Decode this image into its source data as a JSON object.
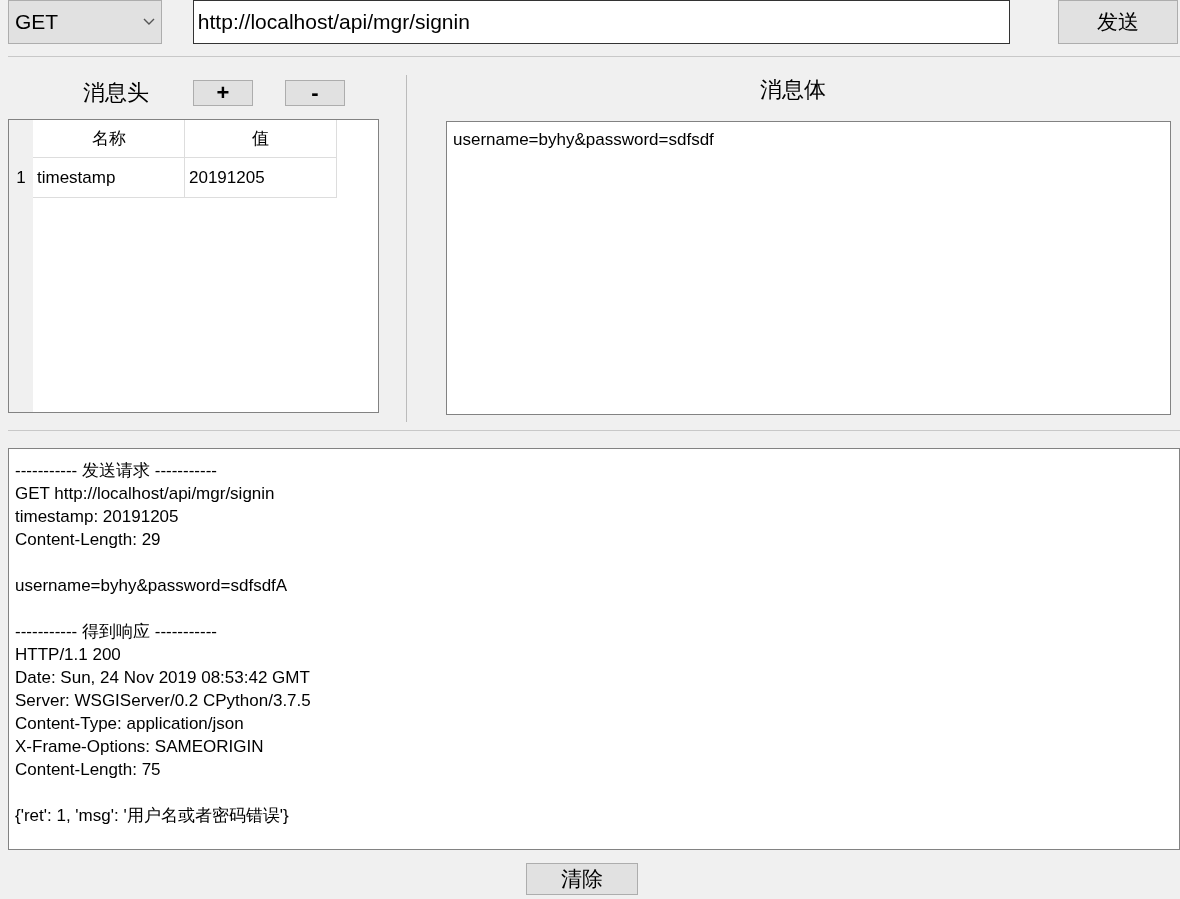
{
  "request": {
    "method": "GET",
    "url": "http://localhost/api/mgr/signin",
    "send_button": "发送"
  },
  "headers_panel": {
    "title": "消息头",
    "add_button": "+",
    "remove_button": "-",
    "table": {
      "columns": [
        "名称",
        "值"
      ],
      "rows": [
        {
          "number": "1",
          "cells": [
            "timestamp",
            "20191205"
          ]
        }
      ]
    }
  },
  "body_panel": {
    "title": "消息体",
    "value": "username=byhy&password=sdfsdf"
  },
  "log": [
    [
      "----------- 发送请求 -----------",
      "GET http://localhost/api/mgr/signin",
      "timestamp: 20191205",
      "Content-Length: 29"
    ],
    [
      "username=byhy&password=sdfsdfA"
    ],
    [
      "----------- 得到响应 -----------",
      "HTTP/1.1 200",
      "Date: Sun, 24 Nov 2019 08:53:42 GMT",
      "Server: WSGIServer/0.2 CPython/3.7.5",
      "Content-Type: application/json",
      "X-Frame-Options: SAMEORIGIN",
      "Content-Length: 75"
    ],
    [
      "{'ret': 1, 'msg': '用户名或者密码错误'}"
    ]
  ],
  "clear_button": "清除"
}
